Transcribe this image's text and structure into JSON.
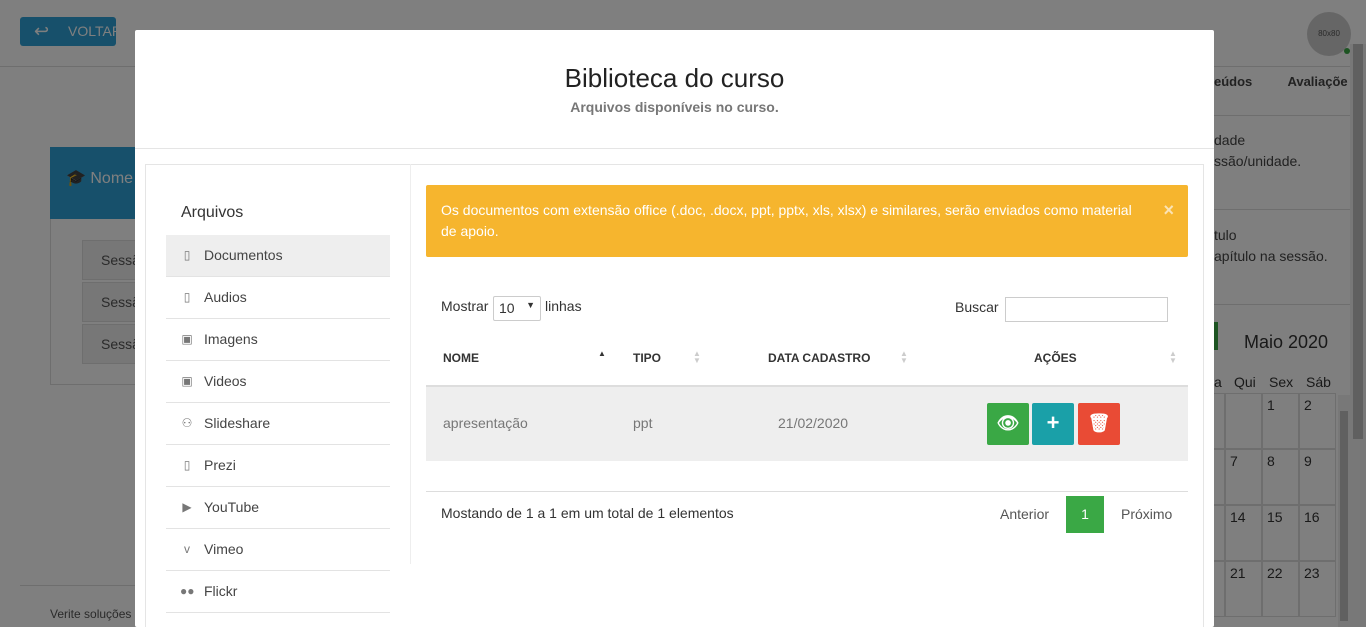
{
  "background": {
    "back_label": "VOLTAR",
    "avatar_label": "80x80",
    "tabs": [
      "eúdos",
      "Avaliaçõe"
    ],
    "panel_header": "Nome",
    "sessions": [
      "Sessã",
      "Sessã",
      "Sessã"
    ],
    "right_texts": [
      [
        "dade",
        "ssão/unidade."
      ],
      [
        "tulo",
        "apítulo na sessão."
      ]
    ],
    "calendar": {
      "month": "Maio 2020",
      "days_header": [
        "a",
        "Qui",
        "Sex",
        "Sáb"
      ],
      "rows": [
        [
          "",
          "",
          "1",
          "2"
        ],
        [
          "",
          "7",
          "8",
          "9"
        ],
        [
          "",
          "14",
          "15",
          "16"
        ],
        [
          "",
          "21",
          "22",
          "23"
        ]
      ]
    },
    "footer": "Verite soluções"
  },
  "modal": {
    "title": "Biblioteca do curso",
    "subtitle": "Arquivos disponíveis no curso.",
    "sidebar": {
      "title": "Arquivos",
      "items": [
        {
          "label": "Documentos",
          "icon": "file-pdf-icon",
          "glyph": "▯"
        },
        {
          "label": "Audios",
          "icon": "file-audio-icon",
          "glyph": "▯"
        },
        {
          "label": "Imagens",
          "icon": "file-image-icon",
          "glyph": "▣"
        },
        {
          "label": "Videos",
          "icon": "file-video-icon",
          "glyph": "▣"
        },
        {
          "label": "Slideshare",
          "icon": "slideshare-icon",
          "glyph": "⚇"
        },
        {
          "label": "Prezi",
          "icon": "file-prezi-icon",
          "glyph": "▯"
        },
        {
          "label": "YouTube",
          "icon": "youtube-icon",
          "glyph": "▶"
        },
        {
          "label": "Vimeo",
          "icon": "vimeo-icon",
          "glyph": "v"
        },
        {
          "label": "Flickr",
          "icon": "flickr-icon",
          "glyph": "●●"
        }
      ]
    },
    "alert": {
      "text": "Os documentos com extensão office (.doc, .docx, ppt, pptx, xls, xlsx) e similares, serão enviados como material de apoio.",
      "close": "×"
    },
    "table": {
      "show_label": "Mostrar",
      "length_value": "10",
      "lines_label": "linhas",
      "search_label": "Buscar",
      "search_value": "",
      "columns": [
        "NOME",
        "TIPO",
        "DATA CADASTRO",
        "AÇÕES"
      ],
      "rows": [
        {
          "nome": "apresentação",
          "tipo": "ppt",
          "data": "21/02/2020"
        }
      ],
      "actions": {
        "view": "👁",
        "add": "+",
        "delete": "🗑"
      },
      "info": "Mostando de 1 a 1 em um total de 1 elementos",
      "prev": "Anterior",
      "current_page": "1",
      "next": "Próximo"
    }
  }
}
